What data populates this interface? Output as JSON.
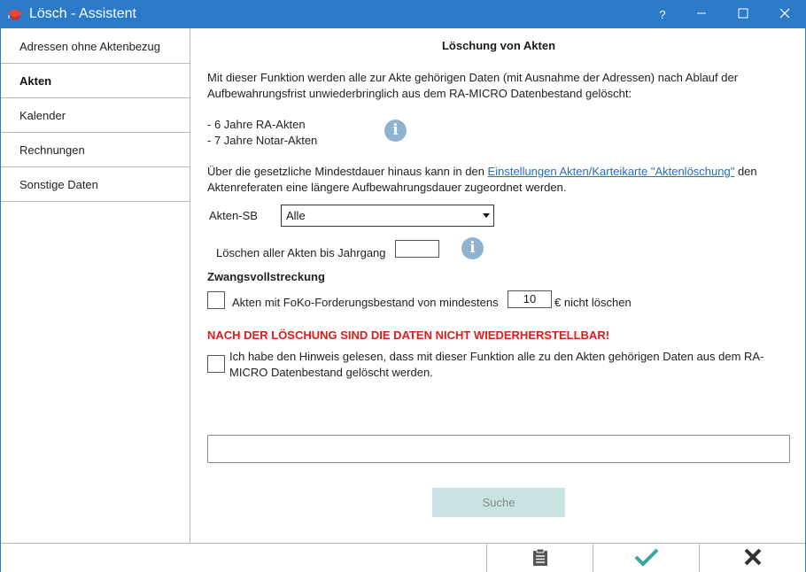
{
  "window": {
    "title": "Lösch - Assistent",
    "titlebar_color": "#2b79c9",
    "help_label": "?"
  },
  "sidebar": {
    "items": [
      {
        "label": "Adressen ohne Aktenbezug",
        "active": false
      },
      {
        "label": "Akten",
        "active": true
      },
      {
        "label": "Kalender",
        "active": false
      },
      {
        "label": "Rechnungen",
        "active": false
      },
      {
        "label": "Sonstige Daten",
        "active": false
      }
    ]
  },
  "main": {
    "heading": "Löschung von Akten",
    "intro_line1": "Mit dieser Funktion werden alle zur Akte gehörigen Daten (mit Ausnahme der Adressen) nach Ablauf der",
    "intro_line2": "Aufbewahrungsfrist unwiederbringlich aus dem RA-MICRO Datenbestand gelöscht:",
    "retention_ra": "- 6 Jahre RA-Akten",
    "retention_notar": "- 7 Jahre Notar-Akten",
    "extra_line1_prefix": "Über die gesetzliche Mindestdauer hinaus kann in den ",
    "extra_link": "Einstellungen Akten/Karteikarte \"Aktenlöschung\"",
    "extra_line1_suffix": " den",
    "extra_line2": "Aktenreferaten eine längere Aufbewahrungsdauer zugeordnet werden.",
    "akten_sb_label": "Akten-SB",
    "akten_sb_value": "Alle",
    "jahrgang_label": "Löschen aller Akten bis Jahrgang",
    "jahrgang_value": "",
    "zv_heading": "Zwangsvollstreckung",
    "foko_label_before": "Akten mit FoKo-Forderungsbestand von mindestens",
    "foko_value": "10",
    "foko_label_after": "€ nicht löschen",
    "warning": "NACH DER LÖSCHUNG SIND DIE DATEN NICHT WIEDERHERSTELLBAR!",
    "warning_color": "#e01b1b",
    "confirm_line1": "Ich habe den Hinweis gelesen, dass mit dieser Funktion alle zu den Akten gehörigen Daten aus dem RA-",
    "confirm_line2": "MICRO Datenbestand gelöscht werden.",
    "result_value": "",
    "search_label": "Suche"
  },
  "bottombar": {
    "icons": [
      "clipboard-icon",
      "checkmark-icon",
      "close-icon"
    ],
    "check_color": "#3aa6a0"
  }
}
